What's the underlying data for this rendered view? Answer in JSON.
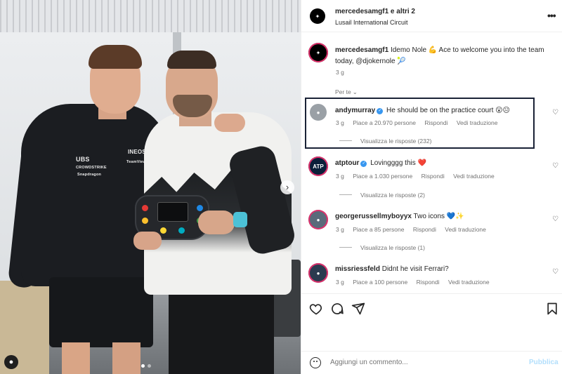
{
  "header": {
    "username": "mercedesamgf1 e altri 2",
    "location": "Lusail International Circuit"
  },
  "caption": {
    "username": "mercedesamgf1",
    "text": "Idemo Nole 💪 Ace to welcome you into the team today, @djokernole 🎾",
    "time": "3 g",
    "for_you": "Per te"
  },
  "comments": [
    {
      "username": "andymurray",
      "verified": true,
      "text": "He should be on the practice court 😮😐",
      "time": "3 g",
      "likes": "Piace a 20.970 persone",
      "reply": "Rispondi",
      "translate": "Vedi traduzione",
      "replies": "Visualizza le risposte (232)"
    },
    {
      "username": "atptour",
      "verified": true,
      "text": "Lovingggg this ❤️",
      "time": "3 g",
      "likes": "Piace a 1.030 persone",
      "reply": "Rispondi",
      "translate": "Vedi traduzione",
      "replies": "Visualizza le risposte (2)"
    },
    {
      "username": "georgerussellmyboyyx",
      "verified": false,
      "text": "Two icons 💙✨",
      "time": "3 g",
      "likes": "Piace a 85 persone",
      "reply": "Rispondi",
      "translate": "Vedi traduzione",
      "replies": "Visualizza le risposte (1)"
    },
    {
      "username": "missriessfeld",
      "verified": false,
      "text": "Didnt he visit Ferrari?",
      "time": "3 g",
      "likes": "Piace a 100 persone",
      "reply": "Rispondi",
      "translate": "Vedi traduzione"
    }
  ],
  "photo_text": {
    "ubs": "UBS",
    "ineos": "INEOS",
    "crowdstrike": "CROWDSTRIKE",
    "teamviewer": "TeamViewer",
    "snapdragon": "Snapdragon",
    "atp": "ATP"
  },
  "add_comment": {
    "placeholder": "Aggiungi un commento...",
    "publish": "Pubblica"
  },
  "colors": {
    "verified": "#3897f0",
    "publish_disabled": "#b2dffc",
    "highlight_border": "#1a2236"
  }
}
